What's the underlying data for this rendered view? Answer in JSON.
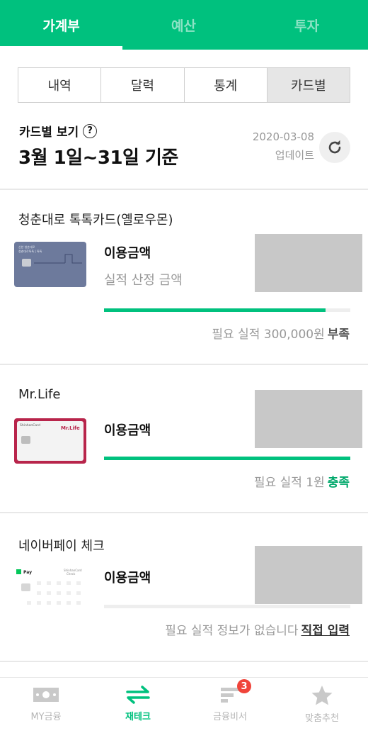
{
  "top_tabs": [
    "가계부",
    "예산",
    "투자"
  ],
  "segments": [
    "내역",
    "달력",
    "통계",
    "카드별"
  ],
  "header": {
    "title": "카드별 보기",
    "help": "?",
    "period": "3월 1일~31일 기준",
    "update_date": "2020-03-08",
    "update_label": "업데이트"
  },
  "cards": [
    {
      "name": "청춘대로 톡톡카드(옐로우몬)",
      "usage_label": "이용금액",
      "perf_label": "실적 산정 금액",
      "progress": 0.9,
      "requirement": "필요 실적 300,000원",
      "status": "부족",
      "card_text": "청춘대로톡톡 | 톡톡"
    },
    {
      "name": "Mr.Life",
      "usage_label": "이용금액",
      "progress": 1.0,
      "requirement": "필요 실적 1원",
      "status": "충족",
      "card_text": "Mr.Life",
      "card_brand": "ShinhanCard"
    },
    {
      "name": "네이버페이 체크",
      "usage_label": "이용금액",
      "progress": 0.0,
      "requirement": "필요 실적 정보가 없습니다",
      "status": "직접 입력",
      "card_text": "Pay",
      "card_brand": "ShinhanCard",
      "card_sub": "Check"
    }
  ],
  "bottom_nav": [
    {
      "label": "MY금융",
      "icon": "money-icon"
    },
    {
      "label": "재테크",
      "icon": "exchange-icon"
    },
    {
      "label": "금융비서",
      "icon": "list-icon",
      "badge": "3"
    },
    {
      "label": "맞춤추천",
      "icon": "star-icon"
    }
  ],
  "colors": {
    "accent": "#00c17e",
    "badge": "#f0443a"
  }
}
